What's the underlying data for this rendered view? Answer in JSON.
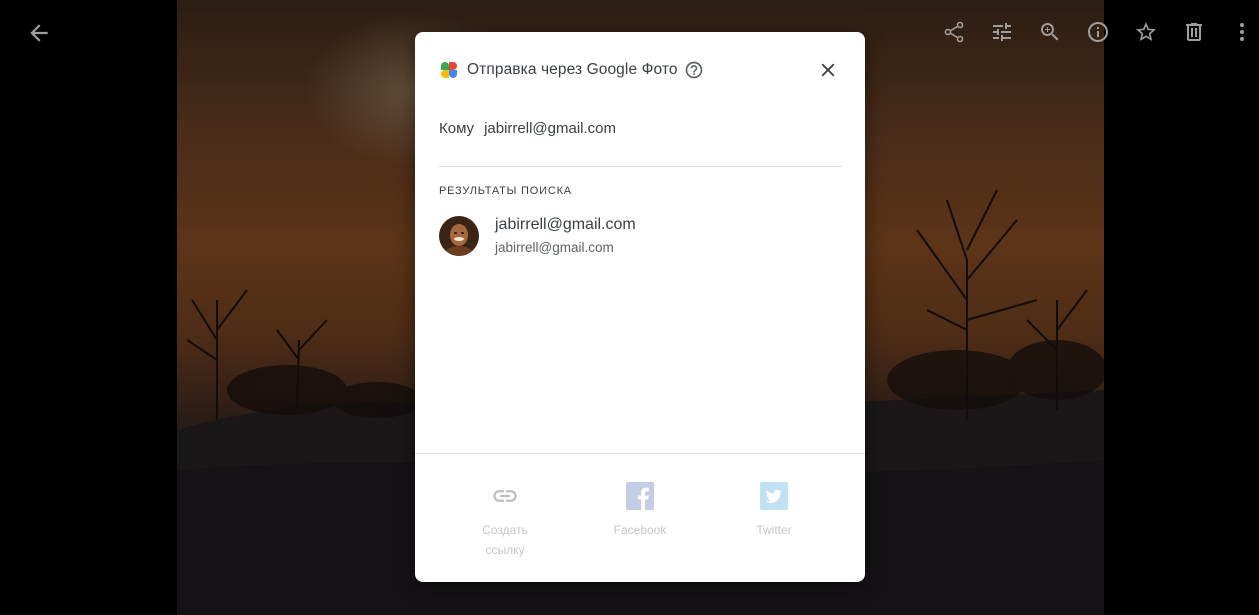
{
  "viewer": {
    "back_icon": "arrow-back-icon",
    "toolbar_icons": [
      "share-icon",
      "edit-tune-icon",
      "zoom-in-icon",
      "info-icon",
      "star-icon",
      "delete-icon",
      "more-vert-icon"
    ]
  },
  "dialog": {
    "title": "Отправка через Google Фото",
    "to_label": "Кому",
    "to_value": "jabirrell@gmail.com",
    "results_label": "РЕЗУЛЬТАТЫ ПОИСКА",
    "contact": {
      "name": "jabirrell@gmail.com",
      "email": "jabirrell@gmail.com"
    },
    "share_options": {
      "link_line1": "Создать",
      "link_line2": "ссылку",
      "facebook": "Facebook",
      "twitter": "Twitter"
    }
  },
  "colors": {
    "share_icon_gray": "#bdbdbd",
    "facebook_faded": "#c5cde6",
    "twitter_faded": "#c2e1f5",
    "text_primary": "#3c4043"
  }
}
